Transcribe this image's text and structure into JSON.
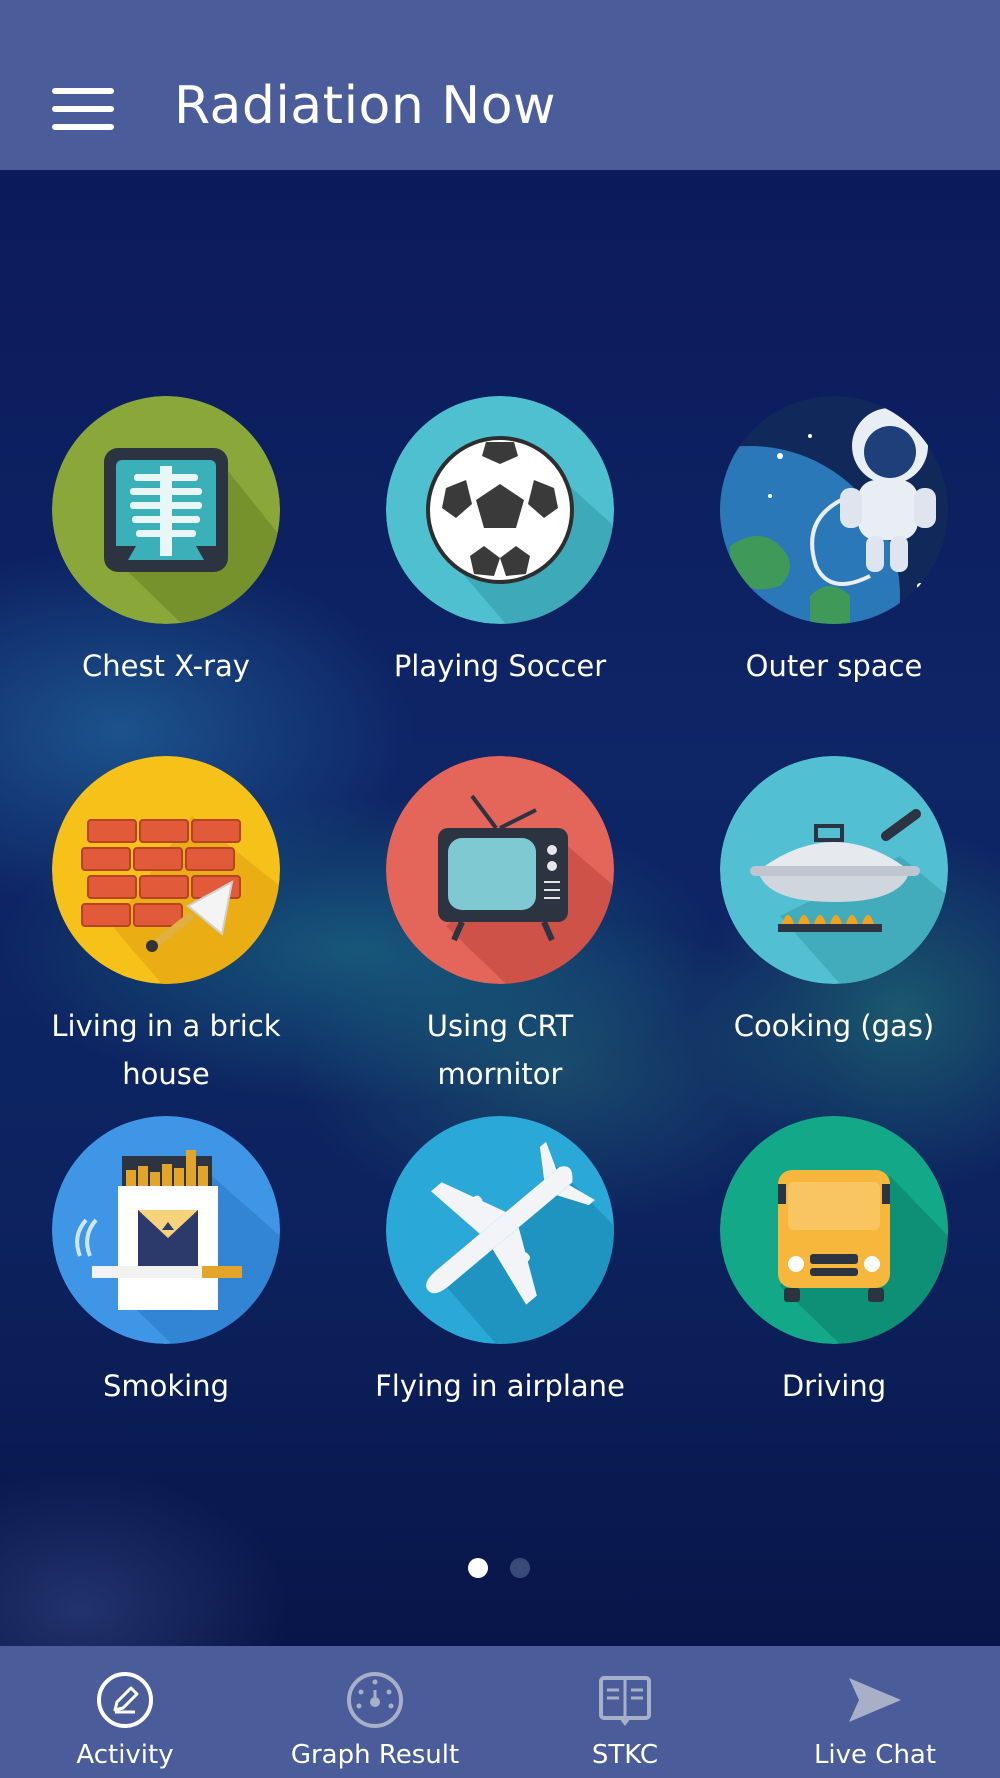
{
  "header": {
    "title": "Radiation Now",
    "menu_icon": "hamburger-menu-icon"
  },
  "tiles": [
    {
      "label": "Chest X-ray",
      "icon": "chest-xray-icon",
      "color": "#8aa83a"
    },
    {
      "label": "Playing Soccer",
      "icon": "soccer-ball-icon",
      "color": "#4fc0d0"
    },
    {
      "label": "Outer space",
      "icon": "astronaut-icon",
      "color": "#0f2a5e"
    },
    {
      "label": "Living in a brick house",
      "icon": "brick-wall-icon",
      "color": "#f6c21a"
    },
    {
      "label": "Using CRT mornitor",
      "icon": "crt-tv-icon",
      "color": "#e4655a"
    },
    {
      "label": "Cooking (gas)",
      "icon": "frying-pan-gas-icon",
      "color": "#52c0d2"
    },
    {
      "label": "Smoking",
      "icon": "cigarette-pack-icon",
      "color": "#3f95e6"
    },
    {
      "label": "Flying in airplane",
      "icon": "airplane-icon",
      "color": "#2aa8d8"
    },
    {
      "label": "Driving",
      "icon": "bus-icon",
      "color": "#12a888"
    }
  ],
  "pager": {
    "current_page": 1,
    "total_pages": 2
  },
  "tabbar": {
    "items": [
      {
        "label": "Activity",
        "icon": "pencil-circle-icon"
      },
      {
        "label": "Graph Result",
        "icon": "gauge-icon"
      },
      {
        "label": "STKC",
        "icon": "book-icon"
      },
      {
        "label": "Live Chat",
        "icon": "send-arrow-icon"
      }
    ]
  }
}
